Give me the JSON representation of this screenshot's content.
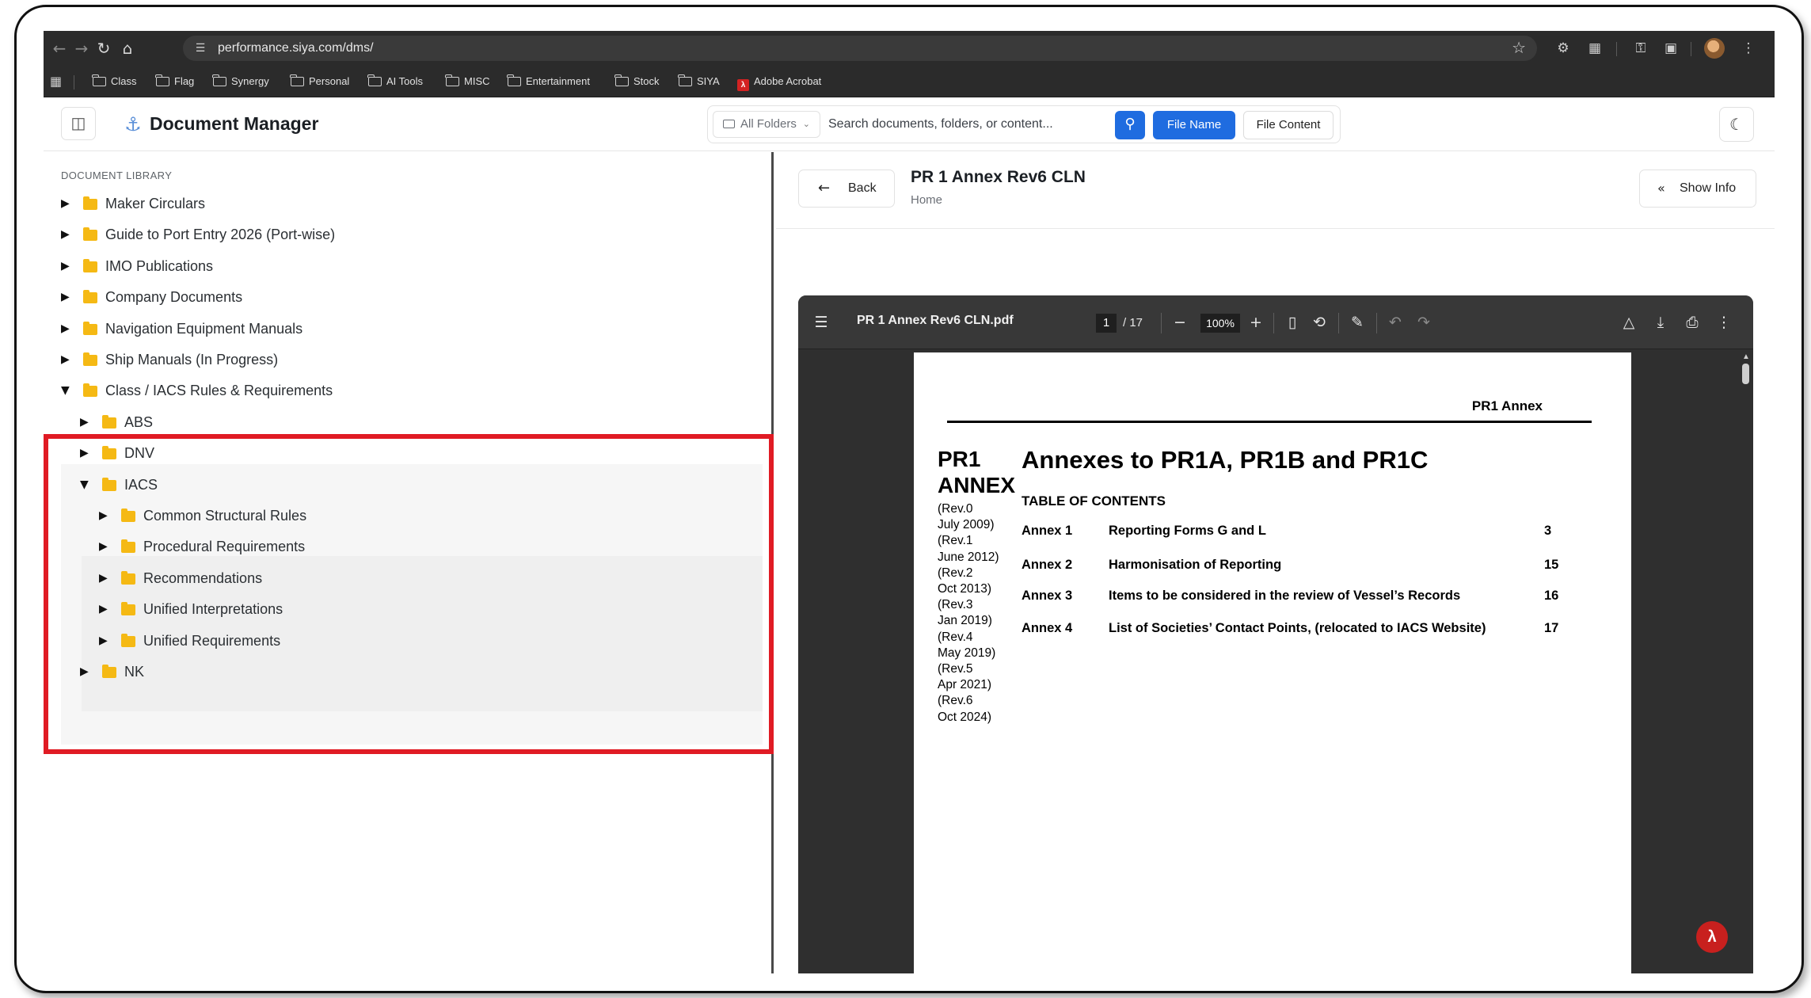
{
  "browser": {
    "url": "performance.siya.com/dms/",
    "bookmarks": [
      {
        "label": "Class",
        "icon": "folder-icon"
      },
      {
        "label": "Flag",
        "icon": "folder-icon"
      },
      {
        "label": "Synergy",
        "icon": "folder-icon"
      },
      {
        "label": "Personal",
        "icon": "folder-icon"
      },
      {
        "label": "AI Tools",
        "icon": "folder-icon"
      },
      {
        "label": "MISC",
        "icon": "folder-icon"
      },
      {
        "label": "Entertainment",
        "icon": "folder-icon"
      },
      {
        "label": "Stock",
        "icon": "folder-icon"
      },
      {
        "label": "SIYA",
        "icon": "folder-icon"
      },
      {
        "label": "Adobe Acrobat",
        "icon": "adobe-acrobat-icon"
      }
    ]
  },
  "app": {
    "title": "Document Manager",
    "search": {
      "folder_filter": "All Folders",
      "placeholder": "Search documents, folders, or content...",
      "file_name_label": "File Name",
      "file_content_label": "File Content"
    }
  },
  "library": {
    "heading": "DOCUMENT LIBRARY",
    "rows": [
      {
        "label": "Maker Circulars",
        "expanded": false,
        "level": 0
      },
      {
        "label": "Guide to Port Entry 2026 (Port-wise)",
        "expanded": false,
        "level": 0
      },
      {
        "label": "IMO Publications",
        "expanded": false,
        "level": 0
      },
      {
        "label": "Company Documents",
        "expanded": false,
        "level": 0
      },
      {
        "label": "Navigation Equipment Manuals",
        "expanded": false,
        "level": 0
      },
      {
        "label": "Ship Manuals (In Progress)",
        "expanded": false,
        "level": 0
      },
      {
        "label": "Class / IACS Rules & Requirements",
        "expanded": true,
        "level": 0
      },
      {
        "label": "ABS",
        "expanded": false,
        "level": 1
      },
      {
        "label": "DNV",
        "expanded": false,
        "level": 1
      },
      {
        "label": "IACS",
        "expanded": true,
        "level": 1
      },
      {
        "label": "Common Structural Rules",
        "expanded": false,
        "level": 2
      },
      {
        "label": "Procedural Requirements",
        "expanded": false,
        "level": 2
      },
      {
        "label": "Recommendations",
        "expanded": false,
        "level": 2
      },
      {
        "label": "Unified Interpretations",
        "expanded": false,
        "level": 2
      },
      {
        "label": "Unified Requirements",
        "expanded": false,
        "level": 2
      },
      {
        "label": "NK",
        "expanded": false,
        "level": 1
      }
    ]
  },
  "document": {
    "back_label": "Back",
    "title": "PR 1 Annex Rev6 CLN",
    "breadcrumb": "Home",
    "show_info_label": "Show Info"
  },
  "viewer": {
    "file_name": "PR 1 Annex Rev6 CLN.pdf",
    "current_page": "1",
    "total_pages": "/ 17",
    "zoom": "100%"
  },
  "pdf_page": {
    "header": "PR1 Annex",
    "side_title_1": "PR1",
    "side_title_2": "ANNEX",
    "revisions": [
      "(Rev.0",
      "July 2009)",
      "(Rev.1",
      "June 2012)",
      "(Rev.2",
      "Oct 2013)",
      "(Rev.3",
      "Jan 2019)",
      "(Rev.4",
      "May 2019)",
      "(Rev.5",
      "Apr 2021)",
      "(Rev.6",
      "Oct 2024)"
    ],
    "title": "Annexes to PR1A, PR1B and PR1C",
    "toc_heading": "TABLE OF CONTENTS",
    "toc": [
      {
        "annex": "Annex 1",
        "desc": "Reporting Forms G and L",
        "page": "3"
      },
      {
        "annex": "Annex 2",
        "desc": "Harmonisation of Reporting",
        "page": "15"
      },
      {
        "annex": "Annex 3",
        "desc": "Items to be considered in the review of Vessel’s Records",
        "page": "16"
      },
      {
        "annex": "Annex 4",
        "desc": "List of Societies’ Contact Points, (relocated to IACS Website)",
        "page": "17"
      }
    ]
  }
}
